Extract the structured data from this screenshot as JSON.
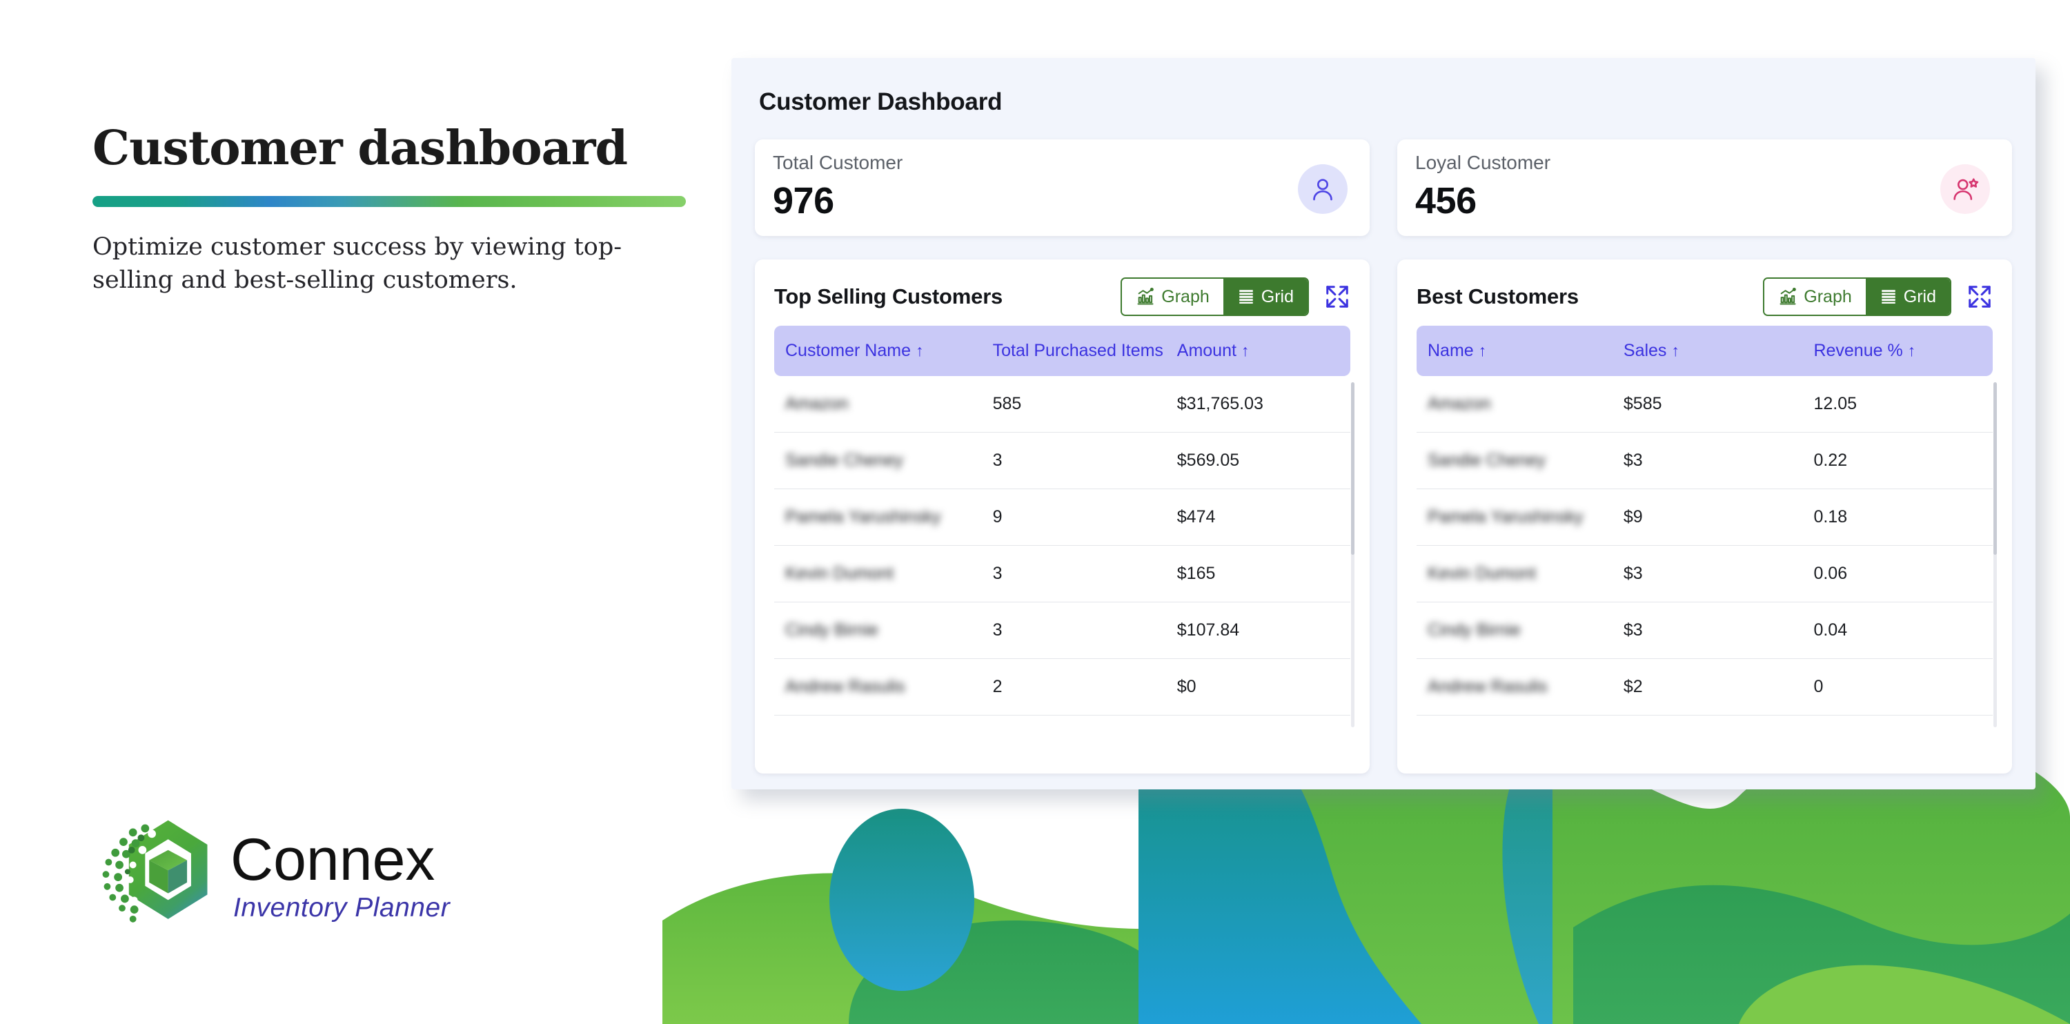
{
  "hero": {
    "title": "Customer dashboard",
    "subtitle": "Optimize customer success by viewing top-selling and best-selling customers."
  },
  "logo": {
    "name": "Connex",
    "tagline": "Inventory Planner"
  },
  "dashboard": {
    "title": "Customer Dashboard",
    "kpis": [
      {
        "label": "Total Customer",
        "value": "976",
        "icon": "user-icon",
        "accent": "#4f46e5",
        "badge_bg": "#e0e2fb"
      },
      {
        "label": "Loyal Customer",
        "value": "456",
        "icon": "user-star-icon",
        "accent": "#d6356f",
        "badge_bg": "#fdecf3"
      }
    ],
    "panels": [
      {
        "title": "Top Selling Customers",
        "toggle": {
          "graph_label": "Graph",
          "grid_label": "Grid",
          "selected": "Grid"
        },
        "expand_label": "Expand",
        "columns": [
          "Customer Name",
          "Total Purchased Items",
          "Amount"
        ],
        "sortable": [
          true,
          false,
          true
        ],
        "rows": [
          [
            "Amazon",
            "585",
            "$31,765.03"
          ],
          [
            "Sandie Cheney",
            "3",
            "$569.05"
          ],
          [
            "Pamela Yarushinsky",
            "9",
            "$474"
          ],
          [
            "Kevin Dumont",
            "3",
            "$165"
          ],
          [
            "Cindy Birnie",
            "3",
            "$107.84"
          ],
          [
            "Andrew Rasulis",
            "2",
            "$0"
          ]
        ]
      },
      {
        "title": "Best Customers",
        "toggle": {
          "graph_label": "Graph",
          "grid_label": "Grid",
          "selected": "Grid"
        },
        "expand_label": "Expand",
        "columns": [
          "Name",
          "Sales",
          "Revenue %"
        ],
        "sortable": [
          true,
          true,
          true
        ],
        "rows": [
          [
            "Amazon",
            "$585",
            "12.05"
          ],
          [
            "Sandie Cheney",
            "$3",
            "0.22"
          ],
          [
            "Pamela Yarushinsky",
            "$9",
            "0.18"
          ],
          [
            "Kevin Dumont",
            "$3",
            "0.06"
          ],
          [
            "Cindy Birnie",
            "$3",
            "0.04"
          ],
          [
            "Andrew Rasulis",
            "$2",
            "0"
          ]
        ]
      }
    ]
  },
  "colors": {
    "panel_bg": "#f2f5fc",
    "table_header_bg": "#c9c9f7",
    "table_header_text": "#3b32e0",
    "seg_green": "#3d7a2e",
    "expand_icon": "#3b32e0",
    "rule_gradient_start": "#16a085",
    "rule_gradient_mid": "#2e86c8",
    "rule_gradient_end": "#86d06a"
  }
}
